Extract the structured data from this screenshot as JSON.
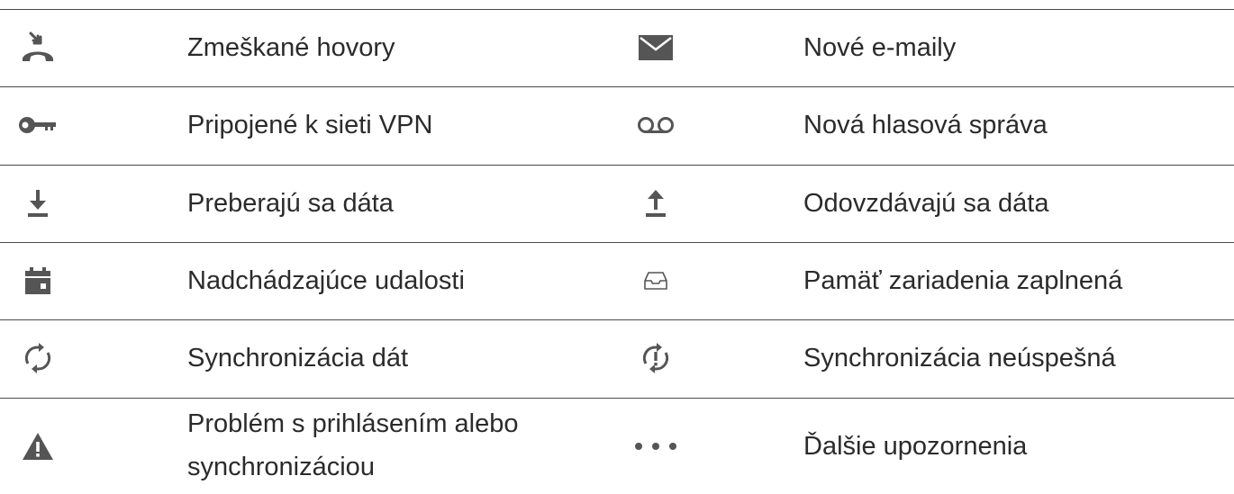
{
  "rows": [
    {
      "left": {
        "icon": "missed-call-icon",
        "label": "Zmeškané hovory"
      },
      "right": {
        "icon": "email-icon",
        "label": "Nové e-maily"
      }
    },
    {
      "left": {
        "icon": "vpn-key-icon",
        "label": "Pripojené k sieti VPN"
      },
      "right": {
        "icon": "voicemail-icon",
        "label": "Nová hlasová správa"
      }
    },
    {
      "left": {
        "icon": "download-icon",
        "label": "Preberajú sa dáta"
      },
      "right": {
        "icon": "upload-icon",
        "label": "Odovzdávajú sa dáta"
      }
    },
    {
      "left": {
        "icon": "calendar-icon",
        "label": "Nadchádzajúce udalosti"
      },
      "right": {
        "icon": "storage-full-icon",
        "label": "Pamäť zariadenia zaplnená"
      }
    },
    {
      "left": {
        "icon": "sync-icon",
        "label": "Synchronizácia dát"
      },
      "right": {
        "icon": "sync-failed-icon",
        "label": "Synchronizácia neúspešná"
      }
    },
    {
      "left": {
        "icon": "warning-icon",
        "label_line1": "Problém s prihlásením alebo",
        "label_line2": "synchronizáciou"
      },
      "right": {
        "icon": "more-dots-icon",
        "label": "Ďalšie upozornenia"
      }
    }
  ],
  "colors": {
    "icon": "#555555",
    "text": "#2b2b2b",
    "rule": "#4a4a4a"
  }
}
